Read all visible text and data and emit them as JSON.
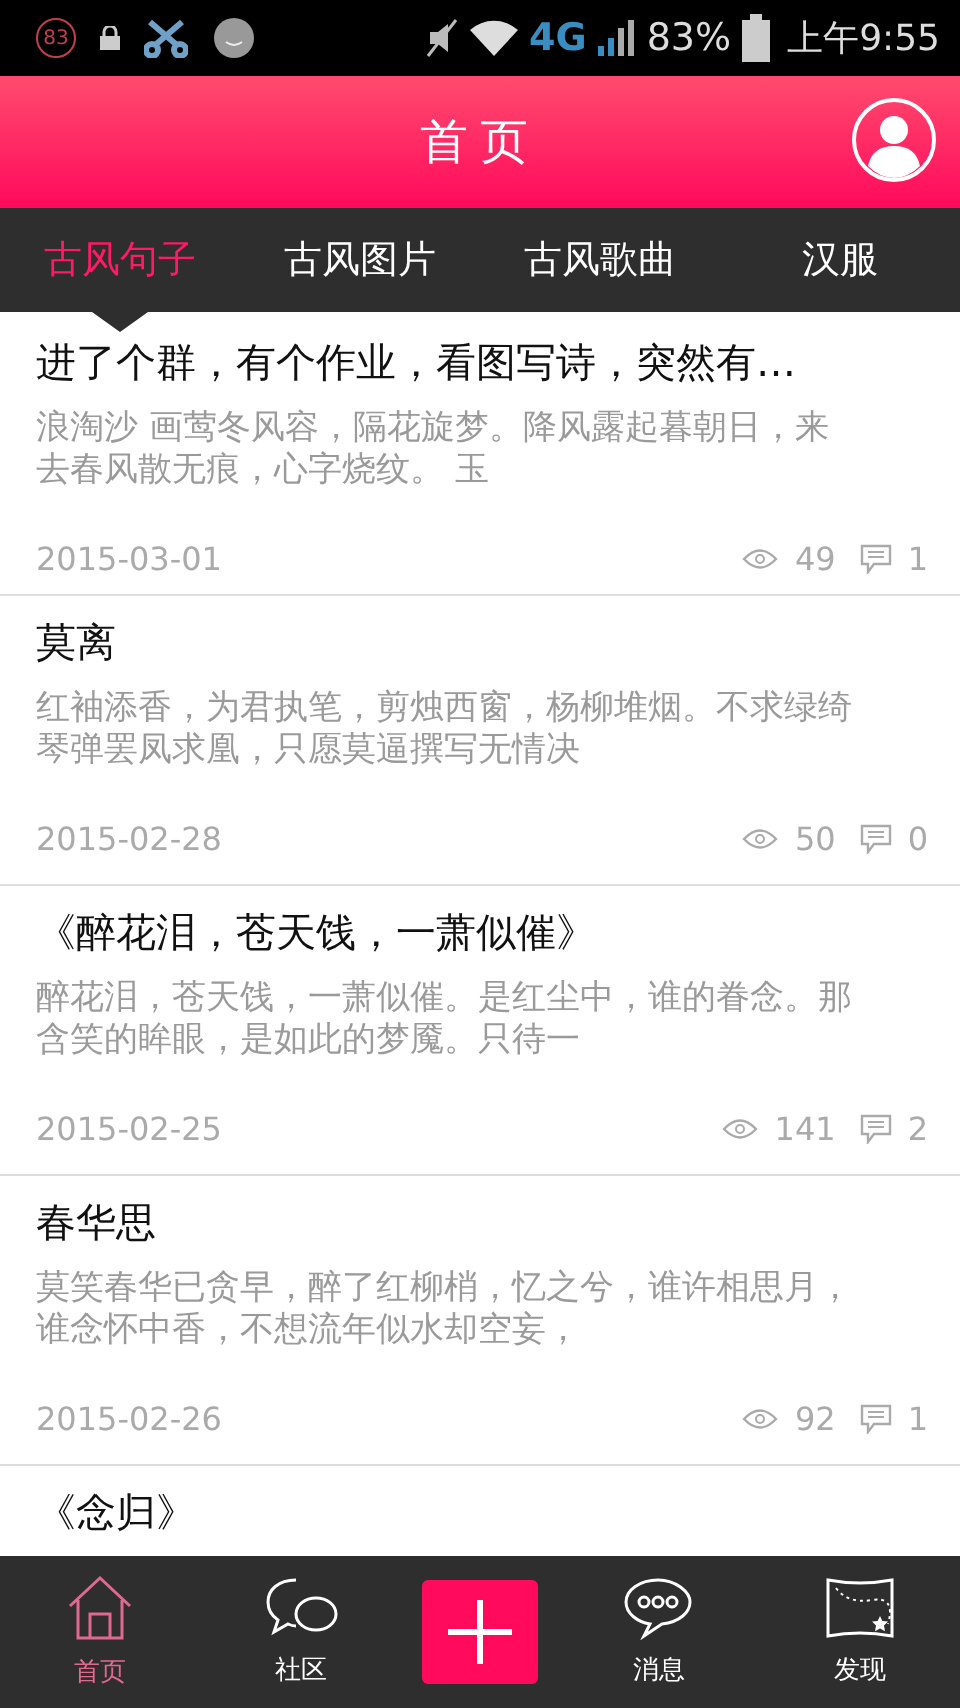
{
  "status_bar": {
    "heart_badge": "83",
    "network": "4G",
    "battery": "83%",
    "time": "上午9:55"
  },
  "header": {
    "title": "首页"
  },
  "tabs": [
    {
      "label": "古风句子",
      "selected": true
    },
    {
      "label": "古风图片",
      "selected": false
    },
    {
      "label": "古风歌曲",
      "selected": false
    },
    {
      "label": "汉服",
      "selected": false
    }
  ],
  "posts": [
    {
      "title": "进了个群，有个作业，看图写诗，突然有…",
      "excerpt": "浪淘沙  画莺冬风容，隔花旋梦。降风露起暮朝日，来去春风散无痕，心字烧纹。 玉",
      "date": "2015-03-01",
      "views": "49",
      "comments": "1"
    },
    {
      "title": "莫离",
      "excerpt": "红袖添香，为君执笔，剪烛西窗，杨柳堆烟。不求绿绮琴弹罢凤求凰，只愿莫逼撰写无情决",
      "date": "2015-02-28",
      "views": "50",
      "comments": "0"
    },
    {
      "title": "《醉花泪，苍天饯，一萧似催》",
      "excerpt": "醉花泪，苍天饯，一萧似催。是红尘中，谁的眷念。那含笑的眸眼，是如此的梦魇。只待一",
      "date": "2015-02-25",
      "views": "141",
      "comments": "2"
    },
    {
      "title": "春华思",
      "excerpt": "莫笑春华已贪早，醉了红柳梢，忆之兮，谁许相思月，谁念怀中香，不想流年似水却空妄，",
      "date": "2015-02-26",
      "views": "92",
      "comments": "1"
    },
    {
      "title": "《念归》"
    }
  ],
  "bottom_nav": [
    {
      "kind": "home",
      "label": "首页",
      "selected": true
    },
    {
      "kind": "community",
      "label": "社区",
      "selected": false
    },
    {
      "kind": "add"
    },
    {
      "kind": "messages",
      "label": "消息",
      "selected": false
    },
    {
      "kind": "discover",
      "label": "发现",
      "selected": false
    }
  ]
}
